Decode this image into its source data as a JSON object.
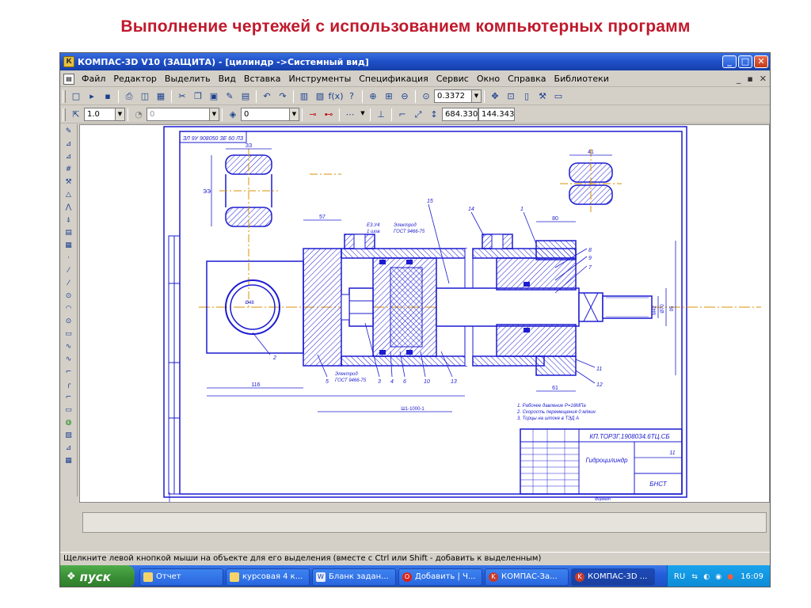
{
  "slide": {
    "title": "Выполнение чертежей с использованием компьютерных программ"
  },
  "window": {
    "title": "КОМПАС-3D V10 (ЗАЩИТА) - [цилиндр ->Системный вид]",
    "app_icon": "kompas-logo",
    "controls": [
      "_",
      "□",
      "✕"
    ]
  },
  "menu": {
    "items": [
      "Файл",
      "Редактор",
      "Выделить",
      "Вид",
      "Вставка",
      "Инструменты",
      "Спецификация",
      "Сервис",
      "Окно",
      "Справка",
      "Библиотеки"
    ],
    "doc_controls": [
      "_",
      "▪",
      "✕"
    ]
  },
  "toolbar1": {
    "zoom_value": "0.3372"
  },
  "toolbar2": {
    "line_scale": "1.0",
    "angle": "0",
    "layer": "0",
    "coord_x": "684.330",
    "coord_y": "144.343"
  },
  "drawing": {
    "stamp_code": "ЗЛ 9У 908050 ЗЕ 60 ЛЗ",
    "dim_top_left": "ЗЗ",
    "dim_57": "57",
    "dim_left_vertical": "ЭЭ",
    "dim_148": "116",
    "dim_right_top": "41",
    "dim_80": "80",
    "dim_61": "61",
    "dim_m42": "М42",
    "dim_d70": "Ø70",
    "dim_95": "95",
    "dim_circle": "Ø48",
    "gost_top": "ГОСТ 9466-75",
    "gost_bottom": "ГОСТ 9466-75",
    "electrode_top": "Электрод",
    "electrode_bottom": "Электрод",
    "weld_note": "ЕЗ.У4",
    "weld_note2": "1 шов",
    "bottom_label": "Ш1-1000-1",
    "callouts": [
      "2",
      "3",
      "4",
      "5",
      "6",
      "7",
      "8",
      "9",
      "10",
      "11",
      "12",
      "13",
      "14",
      "15",
      "1"
    ],
    "notes": [
      "1. Рабочее давление Р=16МПа",
      "2. Скорость перемещения 0 м/мин",
      "3. Торцы на штоке в ТЭД А"
    ],
    "title_block": {
      "doc_code": "КП.ТОРЗГ.1908034.6ТЦ.СБ",
      "doc_name": "Гидроцилиндр",
      "sheet": "11",
      "org": "БНСТ",
      "format": "Формат"
    }
  },
  "statusbar": {
    "hint": "Щелкните левой кнопкой мыши на объекте для его выделения (вместе с Ctrl или Shift - добавить к выделенным)"
  },
  "taskbar": {
    "start_label": "пуск",
    "tasks": [
      {
        "label": "Отчет",
        "icon": "folder-icon"
      },
      {
        "label": "курсовая 4 к...",
        "icon": "folder-icon"
      },
      {
        "label": "Бланк задан...",
        "icon": "word-icon"
      },
      {
        "label": "Добавить | Ч...",
        "icon": "opera-icon"
      },
      {
        "label": "КОМПАС-За...",
        "icon": "kompas-icon"
      },
      {
        "label": "КОМПАС-3D ...",
        "icon": "kompas-icon"
      }
    ],
    "lang": "RU",
    "clock": "16:09"
  },
  "colors": {
    "title_red": "#c0192c",
    "drawing_blue": "#1b1bd1",
    "axis_orange": "#d89000",
    "hatch": "#1b1bd1",
    "xp_blue": "#245edb",
    "start_green": "#3a8f36"
  }
}
